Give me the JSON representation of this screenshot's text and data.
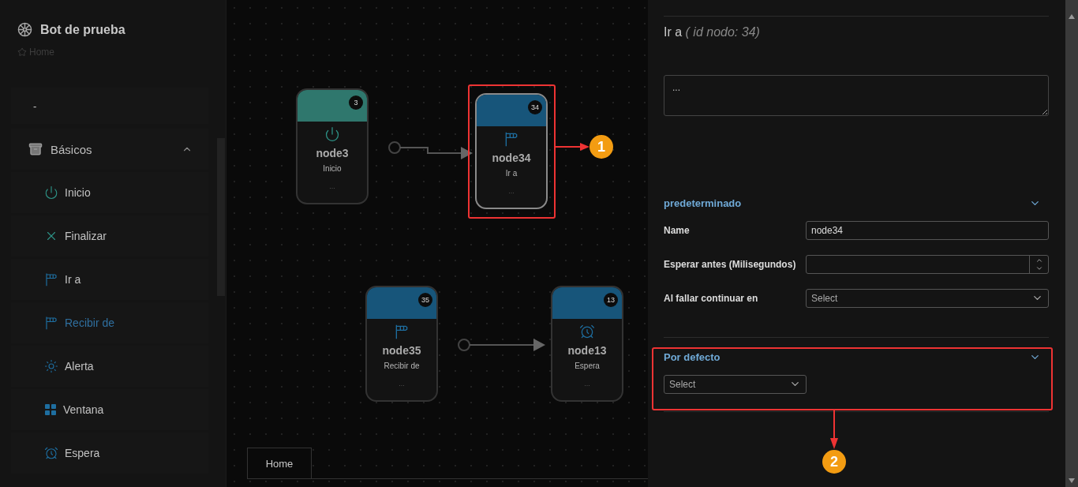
{
  "sidebar": {
    "title": "Bot de prueba",
    "breadcrumb": "Home",
    "collapsed_item": "-",
    "group": {
      "label": "Básicos",
      "expanded": true,
      "items": [
        {
          "label": "Inicio",
          "kind": "power",
          "selected": false
        },
        {
          "label": "Finalizar",
          "kind": "close",
          "selected": false
        },
        {
          "label": "Ir a",
          "kind": "windsock",
          "selected": false
        },
        {
          "label": "Recibir de",
          "kind": "windsock",
          "selected": true
        },
        {
          "label": "Alerta",
          "kind": "sun",
          "selected": false
        },
        {
          "label": "Ventana",
          "kind": "grid",
          "selected": false
        },
        {
          "label": "Espera",
          "kind": "alarm",
          "selected": false
        }
      ]
    }
  },
  "canvas": {
    "nodes": [
      {
        "badge": "3",
        "name": "node3",
        "type_label": "Inicio",
        "note": "...",
        "kind": "power",
        "color": "#2f776d",
        "selected": false
      },
      {
        "badge": "34",
        "name": "node34",
        "type_label": "Ir a",
        "note": "...",
        "kind": "windsock",
        "color": "#17557a",
        "selected": true
      },
      {
        "badge": "35",
        "name": "node35",
        "type_label": "Recibir de",
        "note": "...",
        "kind": "windsock",
        "color": "#17557a",
        "selected": false
      },
      {
        "badge": "13",
        "name": "node13",
        "type_label": "Espera",
        "note": "...",
        "kind": "alarm",
        "color": "#17557a",
        "selected": false
      }
    ],
    "tabs": [
      {
        "label": "Home",
        "selected": true
      }
    ]
  },
  "panel": {
    "title": "Ir a",
    "subtitle": "( id nodo: 34)",
    "description": "...",
    "sections": [
      {
        "title": "predeterminado",
        "expanded": true,
        "fields": [
          {
            "label": "Name",
            "kind": "text",
            "value": "node34"
          },
          {
            "label": "Esperar antes (Milisegundos)",
            "kind": "number"
          },
          {
            "label": "Al fallar continuar en",
            "kind": "select",
            "placeholder": "Select"
          }
        ]
      },
      {
        "title": "Por defecto",
        "expanded": true,
        "fields": [
          {
            "kind": "select",
            "placeholder": "Select"
          }
        ]
      }
    ]
  },
  "annotations": [
    "1",
    "2"
  ]
}
